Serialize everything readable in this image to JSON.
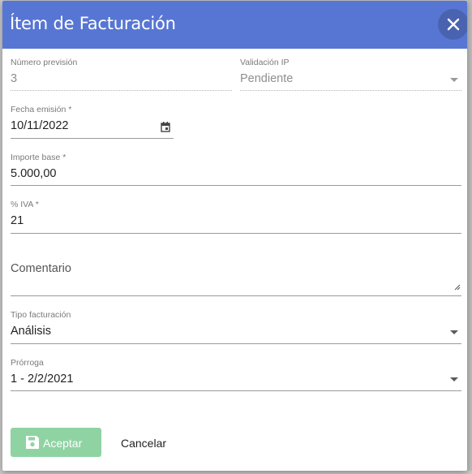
{
  "dialog": {
    "title": "Ítem de Facturación",
    "close_icon": "close-icon"
  },
  "fields": {
    "numero_prevision": {
      "label": "Número previsión",
      "value": "3"
    },
    "validacion_ip": {
      "label": "Validación IP",
      "value": "Pendiente"
    },
    "fecha_emision": {
      "label": "Fecha emisión *",
      "value": "10/11/2022",
      "icon": "calendar-icon"
    },
    "importe_base": {
      "label": "Importe base *",
      "value": "5.000,00"
    },
    "iva": {
      "label": "% IVA *",
      "value": "21"
    },
    "comentario": {
      "placeholder": "Comentario"
    },
    "tipo_facturacion": {
      "label": "Tipo facturación",
      "value": "Análisis"
    },
    "prorroga": {
      "label": "Prórroga",
      "value": "1 - 2/2/2021"
    }
  },
  "actions": {
    "accept_label": "Aceptar",
    "accept_icon": "save-icon",
    "cancel_label": "Cancelar"
  },
  "colors": {
    "header": "#5776d3",
    "close_button": "#4a63b0",
    "accept_button": "#8fd3a3"
  }
}
